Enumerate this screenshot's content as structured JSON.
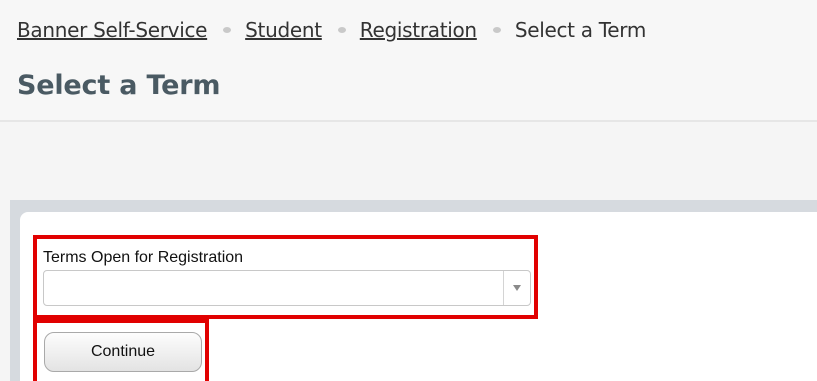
{
  "breadcrumb": {
    "items": [
      {
        "label": "Banner Self-Service"
      },
      {
        "label": "Student"
      },
      {
        "label": "Registration"
      }
    ],
    "current": "Select a Term"
  },
  "page": {
    "title": "Select a Term"
  },
  "form": {
    "term_label": "Terms Open for Registration",
    "term_value": "",
    "continue_label": "Continue"
  },
  "colors": {
    "highlight": "#e10000",
    "title": "#4a5a63",
    "panel": "#d6dadf"
  },
  "icons": {
    "dropdown": "chevron-down-icon",
    "separator": "dot-separator-icon"
  }
}
